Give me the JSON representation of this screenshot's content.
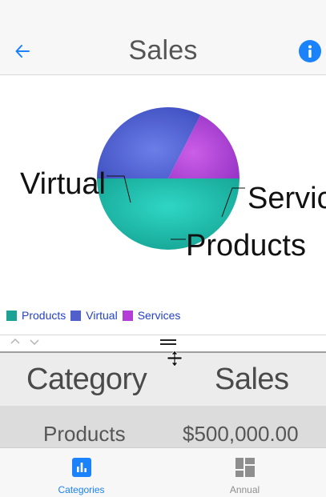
{
  "header": {
    "title": "Sales",
    "back_icon": "back-arrow-icon",
    "info_icon": "info-icon"
  },
  "chart_data": {
    "type": "pie",
    "slices": [
      {
        "label": "Products",
        "value": 500000,
        "color": "#1fb5a6"
      },
      {
        "label": "Virtual",
        "value": 325000,
        "color": "#4f60cc"
      },
      {
        "label": "Services",
        "value": 175000,
        "color": "#b045d6"
      }
    ],
    "callouts": [
      "Virtual",
      "Services",
      "Products"
    ],
    "legend_position": "bottom-left"
  },
  "legend": {
    "items": [
      {
        "label": "Products",
        "color": "#1aa394"
      },
      {
        "label": "Virtual",
        "color": "#4f60cc"
      },
      {
        "label": "Services",
        "color": "#b33dd6"
      }
    ]
  },
  "table": {
    "headers": [
      "Category",
      "Sales"
    ],
    "rows": [
      {
        "category": "Products",
        "sales": "$500,000.00"
      }
    ]
  },
  "tabs": [
    {
      "label": "Categories",
      "icon": "bar-chart-icon",
      "active": true
    },
    {
      "label": "Annual",
      "icon": "dashboard-grid-icon",
      "active": false
    }
  ],
  "colors": {
    "accent": "#1a82fb",
    "legend_text": "#2341c9",
    "inactive": "#8e8e8e"
  }
}
